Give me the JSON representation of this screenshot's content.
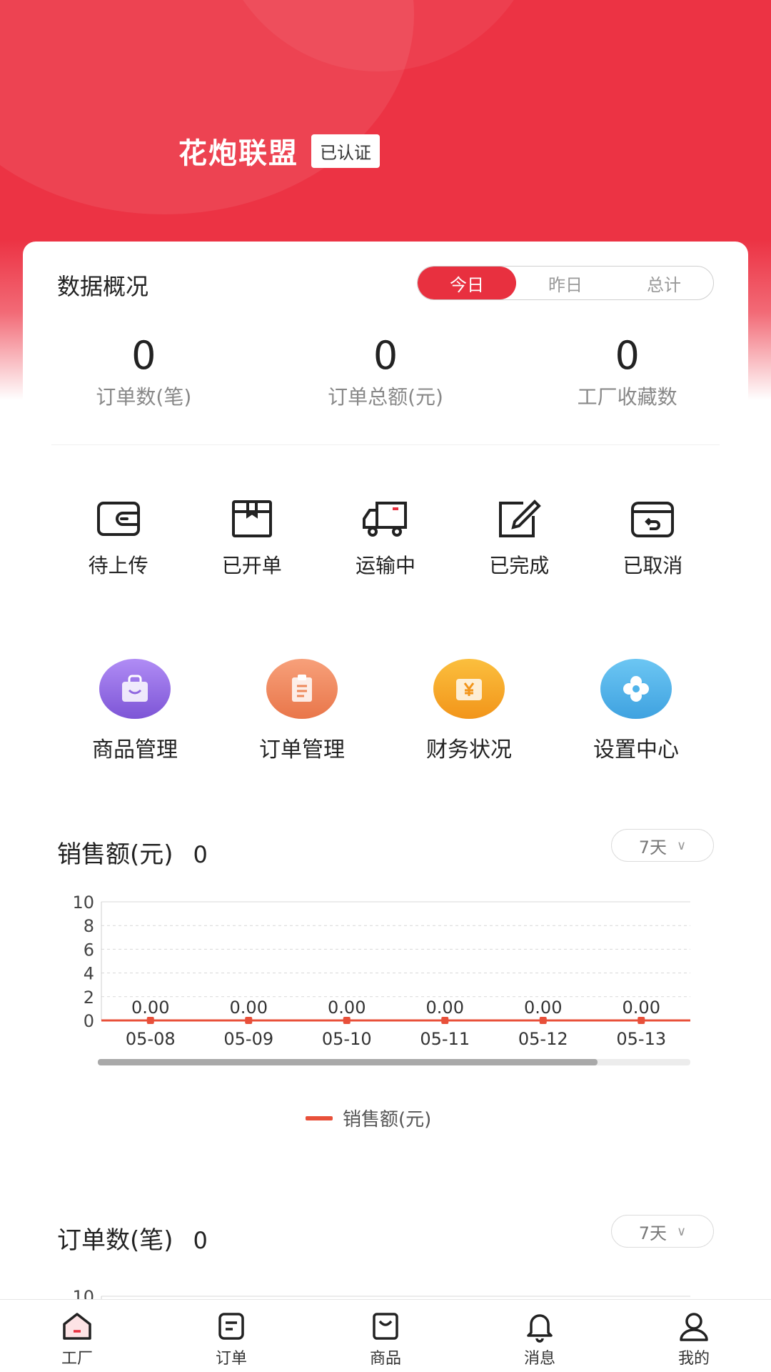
{
  "header": {
    "brand_name": "花炮联盟",
    "verified_badge": "已认证"
  },
  "colors": {
    "primary": "#e8303f",
    "chart_line": "#e8503a",
    "menu_products": "#8f67e0",
    "menu_orders": "#f08a5a",
    "menu_finance": "#f5a623",
    "menu_settings": "#4fb3ea"
  },
  "overview": {
    "title": "数据概况",
    "tabs": [
      {
        "label": "今日",
        "active": true
      },
      {
        "label": "昨日",
        "active": false
      },
      {
        "label": "总计",
        "active": false
      }
    ],
    "stats": [
      {
        "value": "0",
        "label": "订单数(笔)"
      },
      {
        "value": "0",
        "label": "订单总额(元)"
      },
      {
        "value": "0",
        "label": "工厂收藏数"
      }
    ]
  },
  "order_status": [
    {
      "label": "待上传",
      "icon": "wallet-icon"
    },
    {
      "label": "已开单",
      "icon": "box-icon"
    },
    {
      "label": "运输中",
      "icon": "truck-icon"
    },
    {
      "label": "已完成",
      "icon": "edit-icon"
    },
    {
      "label": "已取消",
      "icon": "return-box-icon"
    }
  ],
  "menus": [
    {
      "label": "商品管理",
      "icon": "bag-icon"
    },
    {
      "label": "订单管理",
      "icon": "clipboard-icon"
    },
    {
      "label": "财务状况",
      "icon": "yen-icon"
    },
    {
      "label": "设置中心",
      "icon": "flower-gear-icon"
    }
  ],
  "sales": {
    "title": "销售额(元)",
    "value": "0",
    "range": "7天"
  },
  "orders_count": {
    "title": "订单数(笔)",
    "value": "0",
    "range": "7天"
  },
  "chart_data": [
    {
      "type": "line",
      "categories": [
        "05-08",
        "05-09",
        "05-10",
        "05-11",
        "05-12",
        "05-13"
      ],
      "series": [
        {
          "name": "销售额(元)",
          "values": [
            0,
            0,
            0,
            0,
            0,
            0
          ]
        }
      ],
      "data_labels": [
        "0.00",
        "0.00",
        "0.00",
        "0.00",
        "0.00",
        "0.00"
      ],
      "yticks": [
        "0",
        "2",
        "4",
        "6",
        "8",
        "10"
      ],
      "ylim": [
        0,
        10
      ],
      "grid": true,
      "legend": "bottom-center"
    },
    {
      "type": "line",
      "yticks": [
        "10"
      ],
      "ylim": [
        0,
        10
      ]
    }
  ],
  "tabbar": [
    {
      "label": "工厂",
      "icon": "factory-home-icon"
    },
    {
      "label": "订单",
      "icon": "order-list-icon"
    },
    {
      "label": "商品",
      "icon": "shop-bag-icon"
    },
    {
      "label": "消息",
      "icon": "bell-icon"
    },
    {
      "label": "我的",
      "icon": "user-icon"
    }
  ]
}
